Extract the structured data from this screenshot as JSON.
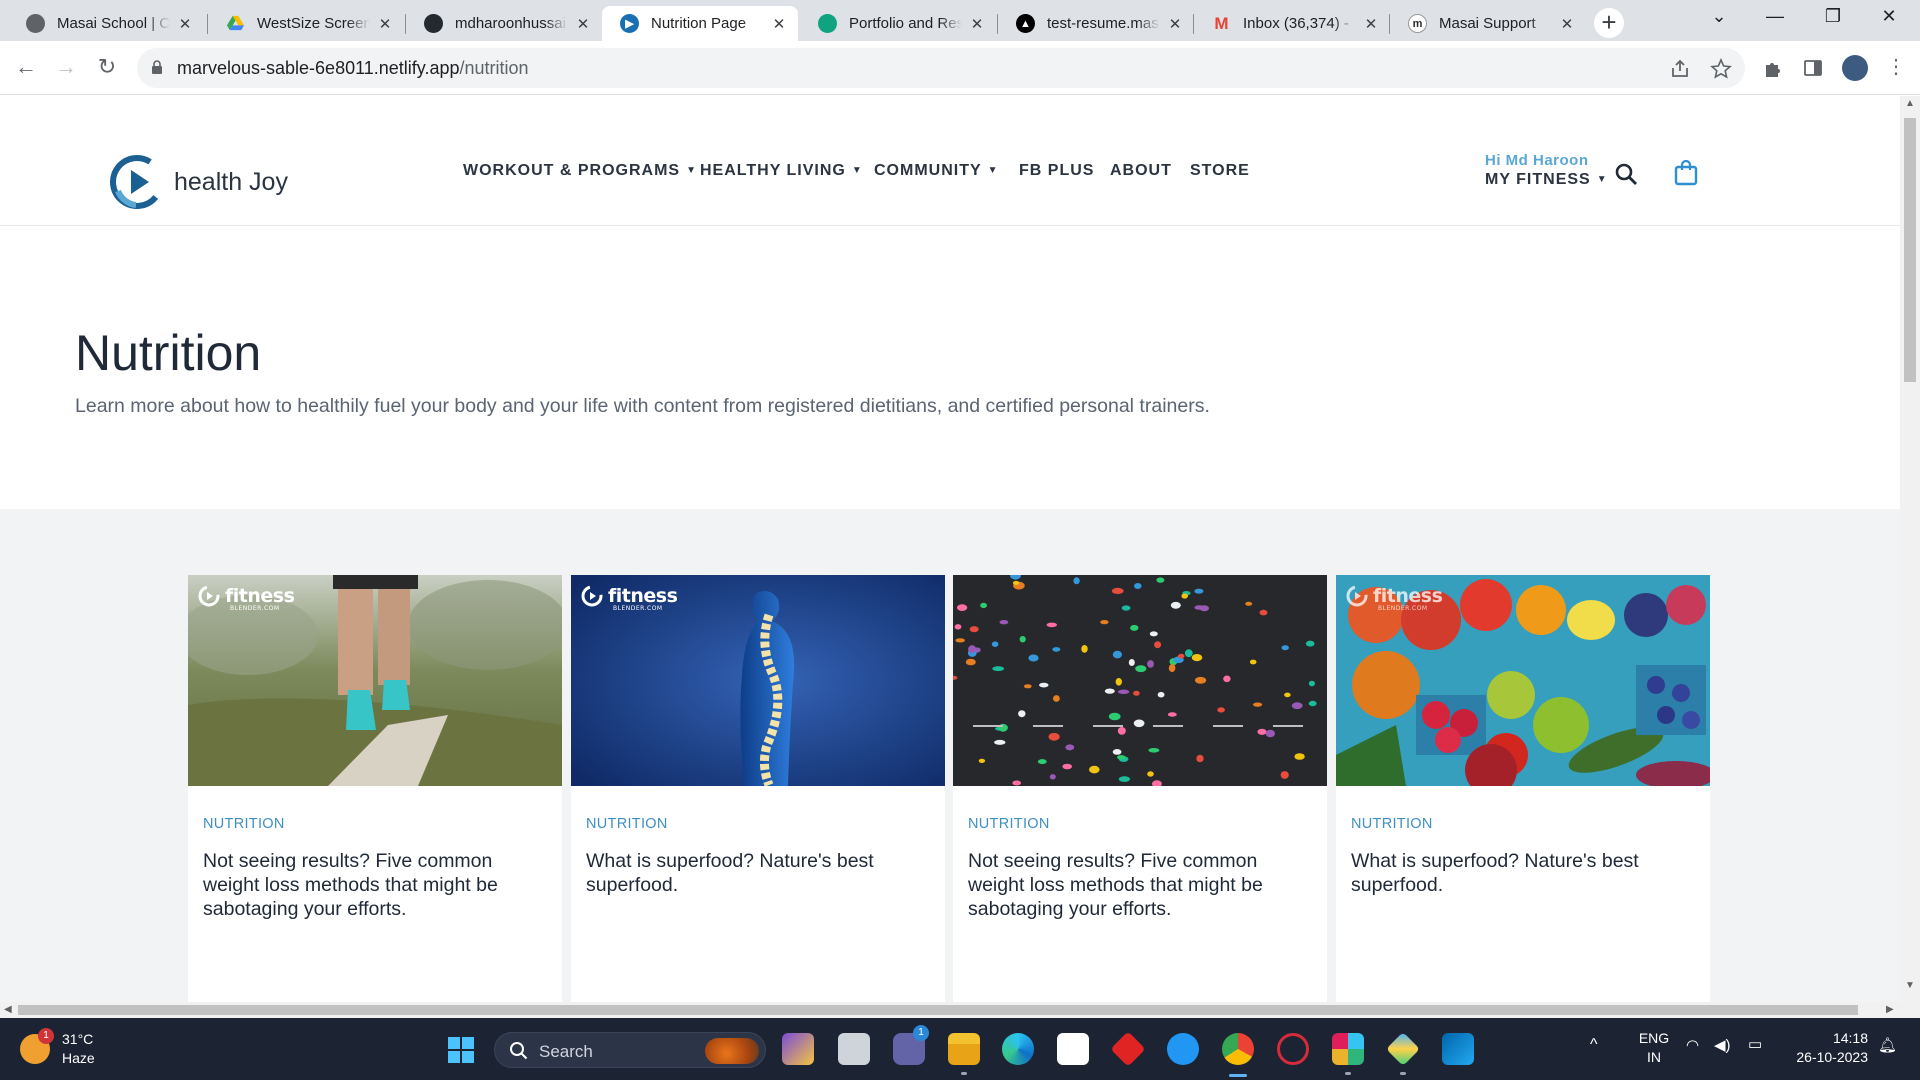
{
  "browser": {
    "tabs": [
      {
        "title": "Masai School | Co",
        "favicon_color": "#5f6368"
      },
      {
        "title": "WestSize Screens",
        "favicon_color": "#34a853"
      },
      {
        "title": "mdharoonhussai",
        "favicon_color": "#24292f"
      },
      {
        "title": "Nutrition Page",
        "favicon_color": "#1a6fb3",
        "active": true
      },
      {
        "title": "Portfolio and Res",
        "favicon_color": "#10a37f"
      },
      {
        "title": "test-resume.mas",
        "favicon_color": "#000000"
      },
      {
        "title": "Inbox (36,374) - ",
        "favicon_color": "#ea4335"
      },
      {
        "title": "Masai Support",
        "favicon_color": "#2b2b2b",
        "favicon_letter": "m"
      }
    ],
    "url_host": "marvelous-sable-6e8011.netlify.app",
    "url_path": "/nutrition"
  },
  "site": {
    "brand": "health Joy",
    "nav": [
      {
        "label": "WORKOUT & PROGRAMS",
        "has_dropdown": true
      },
      {
        "label": "HEALTHY LIVING",
        "has_dropdown": true
      },
      {
        "label": "COMMUNITY",
        "has_dropdown": true
      },
      {
        "label": "FB PLUS",
        "has_dropdown": false
      },
      {
        "label": "ABOUT",
        "has_dropdown": false
      },
      {
        "label": "STORE",
        "has_dropdown": false
      }
    ],
    "caret": "▼",
    "greeting": "Hi Md Haroon",
    "account_label": "MY FITNESS",
    "accent_color": "#3f8fc4"
  },
  "hero": {
    "title": "Nutrition",
    "subtitle": "Learn more about how to healthily fuel your body and your life with content from registered dietitians, and certified personal trainers."
  },
  "cards": [
    {
      "category": "NUTRITION",
      "title": "Not seeing results? Five common weight loss methods that might be sabotaging your efforts.",
      "image": "person-walking-on-log"
    },
    {
      "category": "NUTRITION",
      "title": "What is superfood? Nature's best superfood.",
      "image": "spine-illustration"
    },
    {
      "category": "NUTRITION",
      "title": "Not seeing results? Five common weight loss methods that might be sabotaging your efforts.",
      "image": "aerial-runners"
    },
    {
      "category": "NUTRITION",
      "title": "What is superfood? Nature's best superfood.",
      "image": "fruits-and-vegetables"
    }
  ],
  "image_watermark": {
    "brand": "fitness",
    "sub": "BLENDER.COM"
  },
  "taskbar": {
    "weather_temp": "31°C",
    "weather_desc": "Haze",
    "weather_badge": "1",
    "search_label": "Search",
    "language": "ENG",
    "region": "IN",
    "time": "14:18",
    "date": "26-10-2023",
    "teams_badge": "1"
  }
}
